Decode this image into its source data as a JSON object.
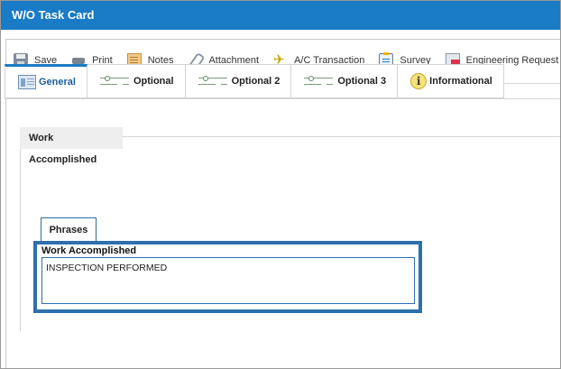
{
  "window": {
    "title": "W/O Task Card"
  },
  "toolbar": {
    "items": [
      {
        "label": "Save",
        "icon": "save-icon"
      },
      {
        "label": "Print",
        "icon": "printer-icon"
      },
      {
        "label": "Notes",
        "icon": "notes-icon"
      },
      {
        "label": "Attachment",
        "icon": "paperclip-icon"
      },
      {
        "label": "A/C Transaction",
        "icon": "airplane-icon"
      },
      {
        "label": "Survey",
        "icon": "clipboard-icon"
      },
      {
        "label": "Engineering Request Review",
        "icon": "engineering-request-icon"
      }
    ]
  },
  "tabs": [
    {
      "label": "General",
      "icon": "form-icon",
      "active": true
    },
    {
      "label": "Optional",
      "icon": "sliders-icon"
    },
    {
      "label": "Optional 2",
      "icon": "sliders-icon"
    },
    {
      "label": "Optional 3",
      "icon": "sliders-icon"
    },
    {
      "label": "Informational",
      "icon": "info-icon",
      "icon_glyph": "i"
    }
  ],
  "section": {
    "title": "Work Accomplished"
  },
  "phrases_button": {
    "label": "Phrases"
  },
  "work_accomplished": {
    "label": "Work Accomplished",
    "value": "INSPECTION PERFORMED"
  },
  "colors": {
    "title_bar": "#1a7bc6",
    "highlight_border": "#2e6fad",
    "active_tab": "#1a7bc6"
  }
}
